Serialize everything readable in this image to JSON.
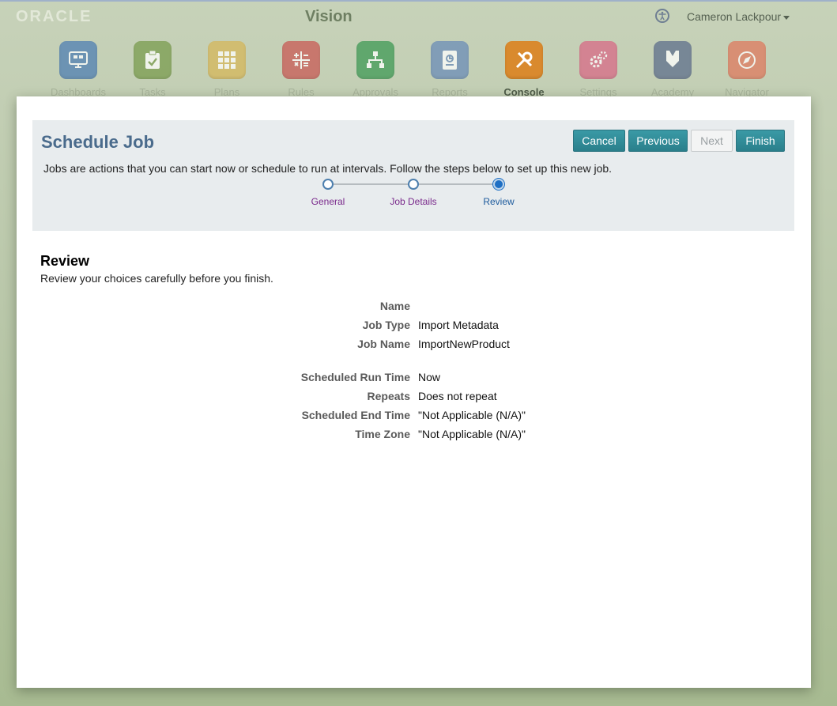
{
  "header": {
    "logo": "ORACLE",
    "app_title": "Vision",
    "user_name": "Cameron Lackpour"
  },
  "nav": [
    {
      "label": "Dashboards",
      "icon": "dashboard-icon",
      "color": "#4f7fb3"
    },
    {
      "label": "Tasks",
      "icon": "clipboard-check-icon",
      "color": "#7a9c4e"
    },
    {
      "label": "Plans",
      "icon": "grid-icon",
      "color": "#d6b75a"
    },
    {
      "label": "Rules",
      "icon": "calculator-icon",
      "color": "#c95a55"
    },
    {
      "label": "Approvals",
      "icon": "hierarchy-icon",
      "color": "#3f9a55"
    },
    {
      "label": "Reports",
      "icon": "report-icon",
      "color": "#6b8db8"
    },
    {
      "label": "Console",
      "icon": "tools-icon",
      "color": "#d98a2e",
      "active": true
    },
    {
      "label": "Settings",
      "icon": "gears-icon",
      "color": "#d86a86"
    },
    {
      "label": "Academy",
      "icon": "academy-icon",
      "color": "#5e6f8c"
    },
    {
      "label": "Navigator",
      "icon": "compass-icon",
      "color": "#df7a5e"
    }
  ],
  "dialog": {
    "title": "Schedule Job",
    "buttons": {
      "cancel": "Cancel",
      "previous": "Previous",
      "next": "Next",
      "finish": "Finish"
    },
    "intro": "Jobs are actions that you can start now or schedule to run at intervals. Follow the steps below to set up this new job.",
    "steps": [
      {
        "label": "General",
        "state": "visited"
      },
      {
        "label": "Job Details",
        "state": "visited"
      },
      {
        "label": "Review",
        "state": "current"
      }
    ],
    "review": {
      "title": "Review",
      "subtitle": "Review your choices carefully before you finish.",
      "rows": [
        {
          "label": "Name",
          "value": ""
        },
        {
          "label": "Job Type",
          "value": "Import Metadata"
        },
        {
          "label": "Job Name",
          "value": "ImportNewProduct"
        },
        {
          "label": "Scheduled Run Time",
          "value": "Now"
        },
        {
          "label": "Repeats",
          "value": "Does not repeat"
        },
        {
          "label": "Scheduled End Time",
          "value": "\"Not Applicable (N/A)\""
        },
        {
          "label": "Time Zone",
          "value": "\"Not Applicable (N/A)\""
        }
      ]
    }
  },
  "colors": {
    "accent_button": "#2f8c98",
    "title_blue": "#4a6b8c",
    "step_visited_text": "#7a2a8c",
    "step_current": "#1e6fc4"
  }
}
